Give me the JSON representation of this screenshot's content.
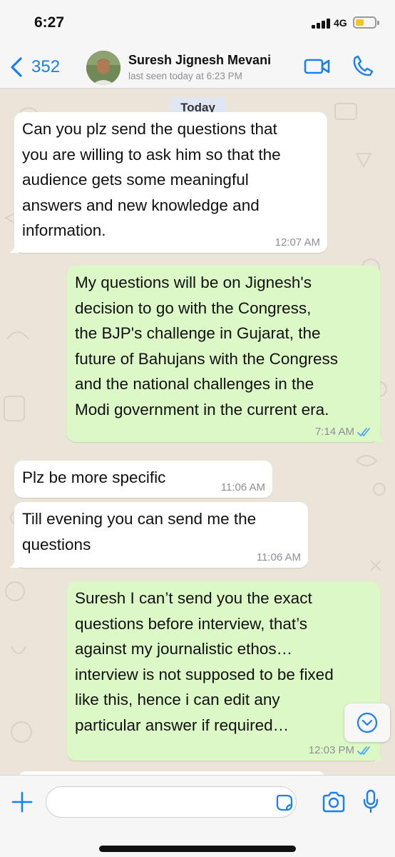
{
  "status_bar": {
    "time": "6:27",
    "network": "4G"
  },
  "header": {
    "back_count": "352",
    "contact_name": "Suresh Jignesh Mevani",
    "last_seen": "last seen today at 6:23 PM"
  },
  "chat": {
    "date_label": "Today",
    "messages": [
      {
        "direction": "incoming",
        "text": "Can you plz send the questions that\nyou are willing to ask him so that the\naudience gets some meaningful\nanswers and new knowledge and\ninformation.",
        "time": "12:07 AM"
      },
      {
        "direction": "outgoing",
        "text": "My questions will be on Jignesh's\ndecision to go with the Congress,\nthe BJP's challenge in Gujarat, the\nfuture of Bahujans with the Congress\nand the national challenges in the\nModi government in the current era.",
        "time": "7:14 AM",
        "status": "read"
      },
      {
        "direction": "incoming",
        "text": "Plz be more specific",
        "time": "11:06 AM"
      },
      {
        "direction": "incoming",
        "text": "Till evening you can send me the\nquestions",
        "time": "11:06 AM"
      },
      {
        "direction": "outgoing",
        "text": "Suresh I can’t send you the exact\nquestions before interview, that’s\nagainst my journalistic ethos…\ninterview is not supposed to be fixed\nlike this, hence i can edit any\nparticular answer if required…",
        "time": "12:03 PM",
        "status": "read"
      }
    ]
  },
  "composer": {
    "placeholder": ""
  },
  "icons": {
    "back": "chevron-left-icon",
    "video": "video-camera-icon",
    "call": "phone-icon",
    "scroll": "chevron-down-circle-icon",
    "attach": "plus-icon",
    "sticker": "sticker-icon",
    "camera": "camera-icon",
    "mic": "microphone-icon",
    "read_receipt": "double-check-icon"
  },
  "colors": {
    "accent": "#1a7ff0",
    "incoming_bubble": "#ffffff",
    "outgoing_bubble": "#dcf8c6",
    "read_ticks": "#4fa8f0",
    "chat_background": "#ebe4d8",
    "date_chip": "#dfe7f2",
    "battery": "#f5c518"
  }
}
